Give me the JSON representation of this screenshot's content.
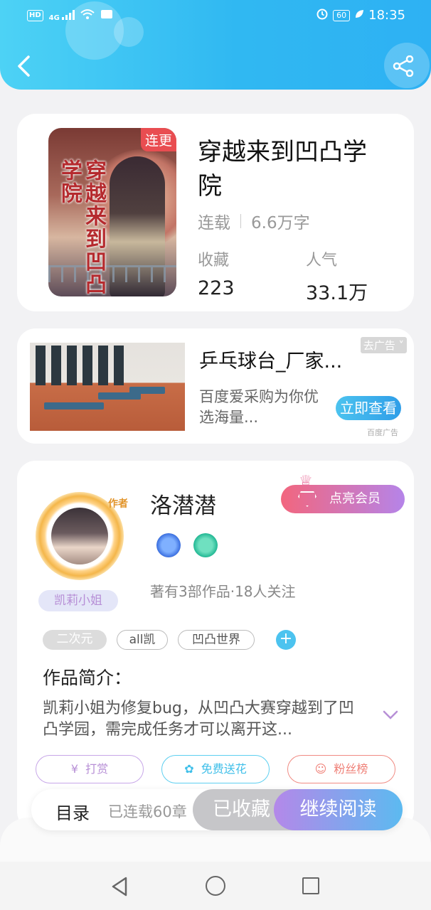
{
  "status_bar": {
    "network": "HD",
    "signal": "4G",
    "battery": "60",
    "time": "18:35"
  },
  "book": {
    "title": "穿越来到凹凸学院",
    "badge": "连更",
    "cover_title": "穿越来到凹凸学院",
    "status": "连载",
    "word_count": "6.6万字",
    "favorites_label": "收藏",
    "favorites_value": "223",
    "popularity_label": "人气",
    "popularity_value": "33.1万"
  },
  "ad": {
    "title": "乒乓球台_厂家...",
    "description": "百度爱采购为你优选海量...",
    "tag": "去广告",
    "button": "立即查看",
    "source": "百度广告"
  },
  "author": {
    "badge": "作者",
    "nickname": "凯莉小姐",
    "name": "洛潜潜",
    "vip_button": "点亮会员",
    "works_info": "著有3部作品·18人关注",
    "tags": [
      "二次元",
      "all凯",
      "凹凸世界"
    ],
    "add_tag": "+",
    "intro_heading": "作品简介：",
    "intro_text": "凯莉小姐为修复bug，从凹凸大赛穿越到了凹凸学园，需完成任务才可以离开这...",
    "actions": {
      "tip": "打赏",
      "flower": "免费送花",
      "fans": "粉丝榜"
    }
  },
  "bottom_bar": {
    "catalog": "目录",
    "serialized": "已连载60章",
    "favorited": "已收藏",
    "continue": "继续阅读"
  },
  "colors": {
    "header_blue": "#30b8f2",
    "accent_red": "#e94d51",
    "accent_purple": "#b78fd6",
    "accent_cyan": "#4cc3ef"
  }
}
